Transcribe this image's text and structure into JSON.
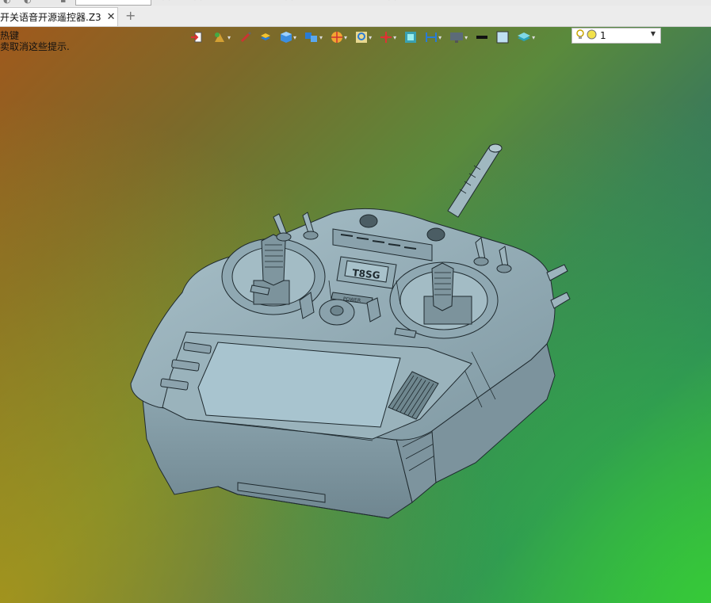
{
  "document_tab": {
    "title": "开关语音开源遥控器.Z3",
    "close_glyph": "✕",
    "new_tab_glyph": "+"
  },
  "viewport": {
    "hint_lines": [
      "热键",
      "卖取消这些提示."
    ],
    "background_colors": [
      "#a0591c",
      "#2d6a6a",
      "#3fcf3a",
      "#b89a14"
    ]
  },
  "view_toolbar": {
    "icons": [
      "exit-view-icon",
      "render-mode-icon",
      "pen-icon",
      "stack-icon",
      "shaded-cube-icon",
      "box-options-icon",
      "color-wheel-icon",
      "magnifier-view-icon",
      "pan-icon",
      "zoom-fit-icon",
      "align-icon",
      "monitor-icon",
      "line-color-swatch-icon",
      "fill-color-swatch-icon",
      "layers-icon"
    ],
    "layer_combo": {
      "value": "1",
      "bulb_icon": "lightbulb-icon",
      "status_icon": "yellow-dot-icon"
    }
  },
  "model": {
    "label_screen": "T8SG",
    "label_brand": "POWER",
    "color_body": "#8fa9b3",
    "color_edge": "#1f2a2f"
  }
}
